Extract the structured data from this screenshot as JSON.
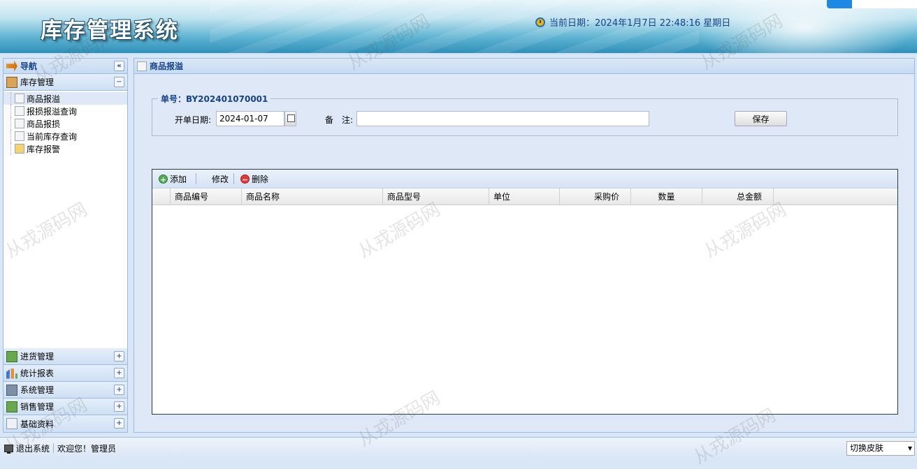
{
  "header": {
    "app_title": "库存管理系统",
    "datetime": "当前日期：2024年1月7日 22:48:16 星期日"
  },
  "nav": {
    "title": "导航",
    "sections": [
      {
        "label": "库存管理",
        "expanded": true,
        "icon": "box-icon"
      },
      {
        "label": "进货管理",
        "icon": "purchase-icon"
      },
      {
        "label": "统计报表",
        "icon": "chart-icon"
      },
      {
        "label": "系统管理",
        "icon": "system-icon"
      },
      {
        "label": "销售管理",
        "icon": "sales-icon"
      },
      {
        "label": "基础资料",
        "icon": "document-icon"
      }
    ],
    "tree_items": [
      "商品报溢",
      "报损报溢查询",
      "商品报损",
      "当前库存查询",
      "库存报警"
    ],
    "selected_item": "商品报溢"
  },
  "main": {
    "panel_title": "商品报溢",
    "order_no_label": "单号：BY202401070001",
    "date_label": "开单日期:",
    "date_value": "2024-01-07",
    "remark_label": "备　注:",
    "remark_value": "",
    "save_label": "保存",
    "toolbar": {
      "add": "添加",
      "edit": "修改",
      "delete": "删除"
    },
    "columns": [
      "商品编号",
      "商品名称",
      "商品型号",
      "单位",
      "采购价",
      "数量",
      "总金额"
    ]
  },
  "statusbar": {
    "logout": "退出系统",
    "welcome": "欢迎您！管理员",
    "skin_select": "切换皮肤"
  },
  "watermark": "从戎源码网",
  "colors": {
    "accent": "#15428b",
    "border": "#99bbe8",
    "panel_bg": "#dfe8f6"
  }
}
